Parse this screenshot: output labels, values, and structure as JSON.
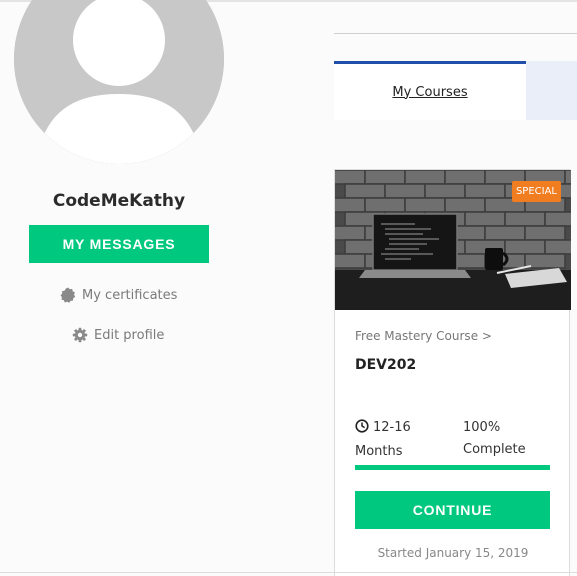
{
  "profile": {
    "username": "CodeMeKathy",
    "messages_button": "MY MESSAGES",
    "certificates_link": "My certificates",
    "edit_profile_link": "Edit profile",
    "icons": {
      "certificates": "badge-icon",
      "edit": "gear-icon"
    }
  },
  "tabs": [
    {
      "label": "My Courses",
      "active": true
    }
  ],
  "course": {
    "badge": "SPECIAL",
    "category": "Free Mastery Course >",
    "code": "DEV202",
    "duration": "12-16 Months",
    "completion": "100% Complete",
    "progress": 1.0,
    "continue_button": "CONTINUE",
    "started": "Started January 15, 2019"
  },
  "colors": {
    "accent_green": "#00c97f",
    "tab_active_border": "#1f4fa8",
    "badge_orange": "#f07d1f"
  }
}
